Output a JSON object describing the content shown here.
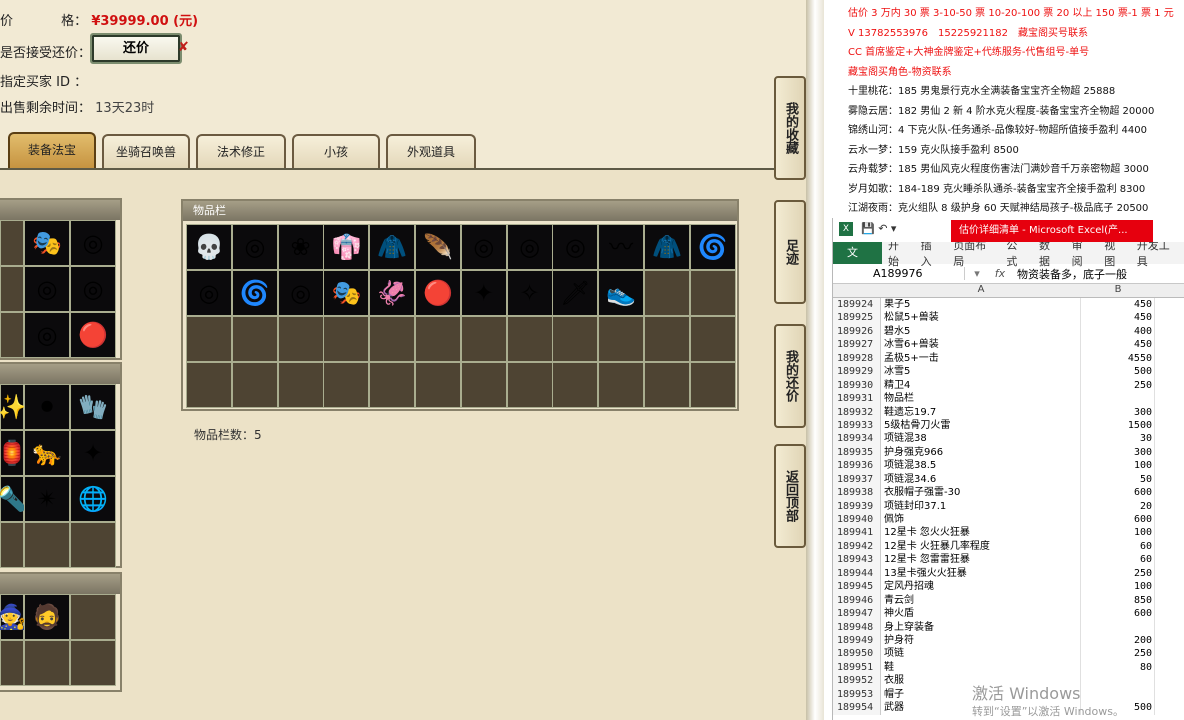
{
  "trade": {
    "price_label": "价　　格：",
    "price_value": "¥39999.00 (元)",
    "accept_counter_label": "是否接受还价：",
    "counter_button": "还价",
    "buyer_id_label": "指定买家 ID ：",
    "remaining_label": "出售剩余时间：",
    "remaining_value": "13天23时",
    "price_prefix": "价"
  },
  "tabs": [
    "装备法宝",
    "坐骑召唤兽",
    "法术修正",
    "小孩",
    "外观道具"
  ],
  "inventory": {
    "title": "物品栏",
    "count_text": "物品栏数：5",
    "row1": [
      "💀",
      "◎",
      "❀",
      "👘",
      "🧥",
      "🪶",
      "◎",
      "◎",
      "◎",
      "〰",
      "🧥",
      "🌀"
    ],
    "row2": [
      "◎",
      "🌀",
      "◎",
      "🎭",
      "🦑",
      "🔴",
      "✦",
      "✧",
      "🗡",
      "👟"
    ]
  },
  "left_grid": {
    "top": [
      "🎭",
      "◎",
      "◎",
      "◎",
      "◎",
      "🔴"
    ],
    "mid": [
      "✨",
      "⚫",
      "🧤",
      "🏮",
      "🐆",
      "✦",
      "🔦",
      "✴",
      "🌐"
    ],
    "bottom": [
      "🧙",
      "🧔"
    ]
  },
  "side_tabs": [
    "我的收藏",
    "足迹",
    "我的还价",
    "返回顶部"
  ],
  "doc_lines": [
    {
      "text": "估价 3 万内 30 票 3-10-50 票 10-20-100 票 20 以上 150 票-1 票 1 元",
      "red": true
    },
    {
      "text": "V 13782553976　15225921182　藏宝阁买号联系",
      "red": true
    },
    {
      "text": "CC 首席鉴定+大神金牌鉴定+代练服务-代售组号-单号",
      "red": true
    },
    {
      "text": "藏宝阁买角色-物资联系",
      "red": true
    },
    {
      "text": "十里桃花：185 男鬼景行克水全满装备宝宝齐全物超 25888",
      "red": false
    },
    {
      "text": "雾隐云居：182 男仙 2 新 4 阶水克火程度-装备宝宝齐全物超 20000",
      "red": false
    },
    {
      "text": "锦绣山河：4 下克火队-任务通杀-品像较好-物超所值接手盈利 4400",
      "red": false
    },
    {
      "text": "云水一梦：159 克火队接手盈利 8500",
      "red": false
    },
    {
      "text": "云舟载梦：185 男仙风克火程度伤害法门满妙音千万亲密物超 3000",
      "red": false
    },
    {
      "text": "岁月如歌：184-189 克火睡杀队通杀-装备宝宝齐全接手盈利 8300",
      "red": false
    },
    {
      "text": "江湖夜雨：克火组队 8 级护身 60 天赋神结局孩子-极品底子 20500",
      "red": false
    }
  ],
  "excel": {
    "title": "估价详细清单 - Microsoft Excel(产...",
    "ribbon": [
      "开始",
      "插入",
      "页面布局",
      "公式",
      "数据",
      "审阅",
      "视图",
      "开发工具"
    ],
    "file_tab": "文件",
    "name_box": "A189976",
    "fx": "fx",
    "formula": "物资装备多，底子一般",
    "col_a": "A",
    "col_b": "B",
    "rows": [
      [
        "189924",
        "果子5",
        "450"
      ],
      [
        "189925",
        "松鼠5+兽装",
        "450"
      ],
      [
        "189926",
        "碧水5",
        "400"
      ],
      [
        "189927",
        "冰雪6+兽装",
        "450"
      ],
      [
        "189928",
        "孟极5+一击",
        "4550"
      ],
      [
        "189929",
        "冰雪5",
        "500"
      ],
      [
        "189930",
        "精卫4",
        "250"
      ],
      [
        "189931",
        "物品栏",
        ""
      ],
      [
        "189932",
        "鞋遗忘19.7",
        "300"
      ],
      [
        "189933",
        "5级枯骨刀火雷",
        "1500"
      ],
      [
        "189934",
        "项链混38",
        "30"
      ],
      [
        "189935",
        "护身强克966",
        "300"
      ],
      [
        "189936",
        "项链混38.5",
        "100"
      ],
      [
        "189937",
        "项链混34.6",
        "50"
      ],
      [
        "189938",
        "衣服帽子强雷-30",
        "600"
      ],
      [
        "189939",
        "项链封印37.1",
        "20"
      ],
      [
        "189940",
        "佩饰",
        "600"
      ],
      [
        "189941",
        "12星卡 忽火火狂暴",
        "100"
      ],
      [
        "189942",
        "12星卡 火狂暴几率程度",
        "60"
      ],
      [
        "189943",
        "12星卡 忽雷雷狂暴",
        "60"
      ],
      [
        "189944",
        "13星卡强火火狂暴",
        "250"
      ],
      [
        "189945",
        "定风丹招魂",
        "100"
      ],
      [
        "189946",
        "青云剑",
        "850"
      ],
      [
        "189947",
        "神火盾",
        "600"
      ],
      [
        "189948",
        "身上穿装备",
        ""
      ],
      [
        "189949",
        "护身符",
        "200"
      ],
      [
        "189950",
        "项链",
        "250"
      ],
      [
        "189951",
        "鞋",
        "80"
      ],
      [
        "189952",
        "衣服",
        ""
      ],
      [
        "189953",
        "帽子",
        ""
      ],
      [
        "189954",
        "武器",
        "500"
      ]
    ]
  },
  "watermark": {
    "line1": "激活 Windows",
    "line2": "转到“设置”以激活 Windows。"
  }
}
